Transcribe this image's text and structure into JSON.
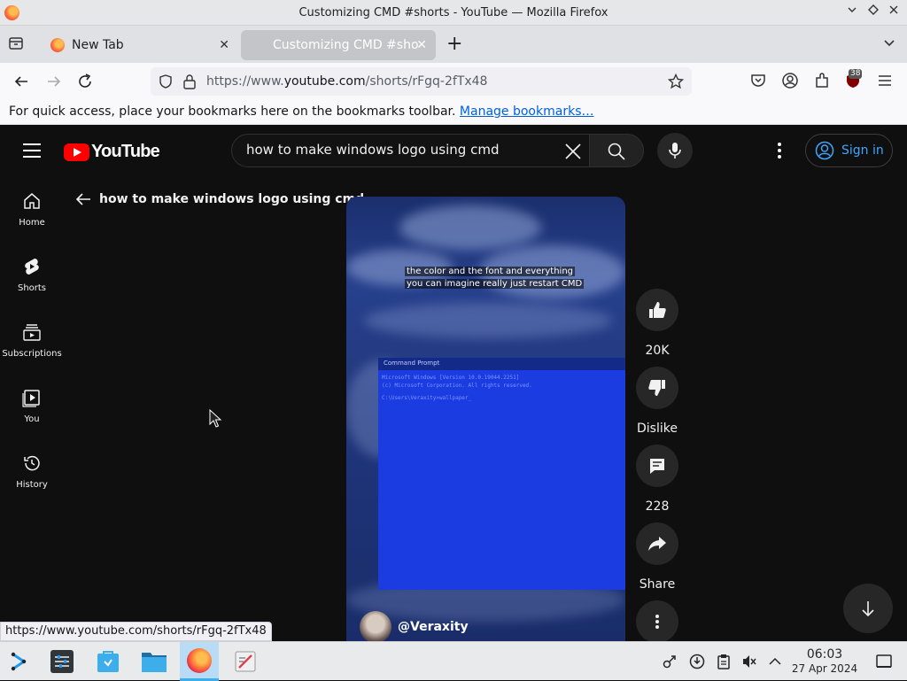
{
  "window": {
    "title": "Customizing CMD #shorts - YouTube — Mozilla Firefox"
  },
  "tabs": [
    {
      "label": "New Tab",
      "favicon": "firefox-icon"
    },
    {
      "label": "Customizing CMD #shorts - YouTube",
      "favicon": "youtube-icon",
      "active": true
    }
  ],
  "navbar": {
    "url_prefix": "https://www.",
    "url_domain": "youtube.com",
    "url_path": "/shorts/rFgq-2fTx48",
    "extension_badge": "38"
  },
  "bookmarks_bar": {
    "text": "For quick access, place your bookmarks here on the bookmarks toolbar.",
    "link": "Manage bookmarks…"
  },
  "youtube": {
    "logo_text": "YouTube",
    "search_value": "how to make windows logo using cmd",
    "sign_in_label": "Sign in",
    "guide": [
      {
        "label": "Home",
        "icon": "home-icon"
      },
      {
        "label": "Shorts",
        "icon": "shorts-icon"
      },
      {
        "label": "Subscriptions",
        "icon": "subscriptions-icon"
      },
      {
        "label": "You",
        "icon": "you-icon"
      },
      {
        "label": "History",
        "icon": "history-icon"
      }
    ],
    "back_query": "how to make windows logo using cmd",
    "short": {
      "caption_line1": "the color and the font and everything",
      "caption_line2": "you can imagine really just restart CMD",
      "cmd_title": "Command Prompt",
      "cmd_line1": "Microsoft Windows [Version 10.0.19044.2251]",
      "cmd_line2": "(c) Microsoft Corporation. All rights reserved.",
      "cmd_line3": "C:\\Users\\Veraxity>wallpaper_",
      "channel": "@Veraxity"
    },
    "actions": {
      "like_count": "20K",
      "dislike_label": "Dislike",
      "comment_count": "228",
      "share_label": "Share"
    }
  },
  "status_link": "https://www.youtube.com/shorts/rFgq-2fTx48",
  "taskbar": {
    "time": "06:03",
    "date": "27 Apr 2024"
  }
}
